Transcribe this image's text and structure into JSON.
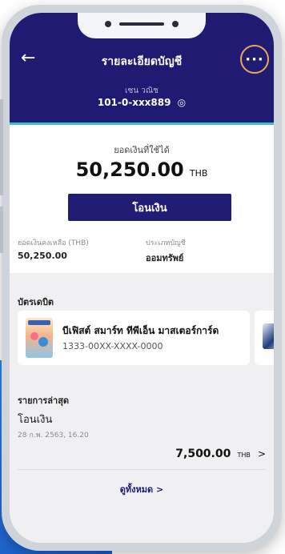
{
  "header": {
    "title": "รายละเอียดบัญชี",
    "account_type": "เซน วณิช",
    "account_number": "101-0-xxx889",
    "eye_icon": "eye-icon",
    "more_icon": "more-icon"
  },
  "balance": {
    "available_label": "ยอดเงินที่ใช้ได้",
    "available_amount": "50,250.00",
    "currency": "THB",
    "transfer_button": "โอนเงิน",
    "remaining_label": "ยอดเงินคงเหลือ (THB)",
    "remaining_value": "50,250.00",
    "account_kind_label": "ประเภทบัญชี",
    "account_kind_value": "ออมทรัพย์"
  },
  "debit_cards": {
    "section_title": "บัตรเดบิต",
    "cards": [
      {
        "name": "บีเฟิสต์ สมาร์ท ทีพีเอ็น มาสเตอร์การ์ด",
        "number": "1333-00XX-XXXX-0000"
      }
    ]
  },
  "recent": {
    "section_title": "รายการล่าสุด",
    "items": [
      {
        "name": "โอนเงิน",
        "date": "28 ก.พ. 2563, 16.20",
        "amount": "7,500.00",
        "currency": "THB"
      }
    ],
    "see_all": "ดูทั้งหมด"
  },
  "colors": {
    "header_bg": "#1f1a72",
    "accent_line": "#36c1d0",
    "more_ring": "#f2a45a",
    "button_bg": "#211c74"
  }
}
